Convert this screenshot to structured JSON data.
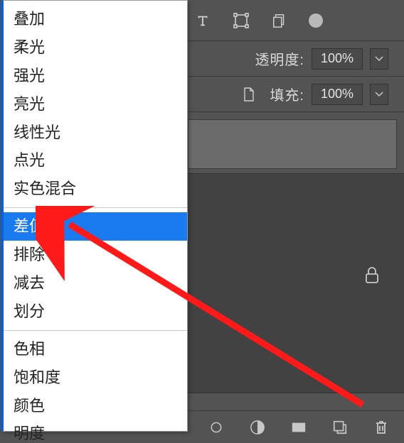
{
  "menu": {
    "group1": [
      "叠加",
      "柔光",
      "强光",
      "亮光",
      "线性光",
      "点光",
      "实色混合"
    ],
    "group2": [
      "差值",
      "排除",
      "减去",
      "划分"
    ],
    "group3": [
      "色相",
      "饱和度",
      "颜色",
      "明度"
    ],
    "selected": "差值"
  },
  "panel": {
    "opacity_label": "透明度:",
    "opacity_value": "100%",
    "fill_label": "填充:",
    "fill_value": "100%"
  }
}
